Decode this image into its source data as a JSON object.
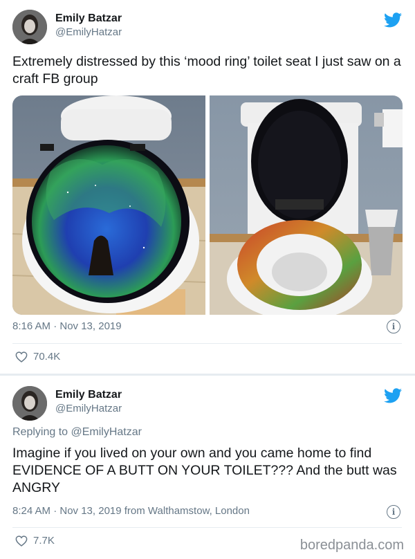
{
  "tweet1": {
    "author_name": "Emily Batzar",
    "author_handle": "@EmilyHatzar",
    "text": "Extremely distressed by this ‘mood ring’ toilet seat I just saw on a craft FB group",
    "timestamp": "8:16 AM · Nov 13, 2019",
    "likes": "70.4K"
  },
  "tweet2": {
    "author_name": "Emily Batzar",
    "author_handle": "@EmilyHatzar",
    "reply_prefix": "Replying to",
    "reply_to": "@EmilyHatzar",
    "text": "Imagine if you lived on your own and you came home to find EVIDENCE OF A BUTT ON YOUR TOILET??? And the butt was ANGRY",
    "timestamp": "8:24 AM · Nov 13, 2019 from Walthamstow, London",
    "likes": "7.7K"
  },
  "watermark": "boredpanda.com",
  "colors": {
    "twitter_blue": "#1da1f2",
    "meta_gray": "#657786",
    "separator": "#e6ecf0"
  },
  "icons": [
    "twitter-bird-icon",
    "info-icon",
    "heart-icon"
  ]
}
